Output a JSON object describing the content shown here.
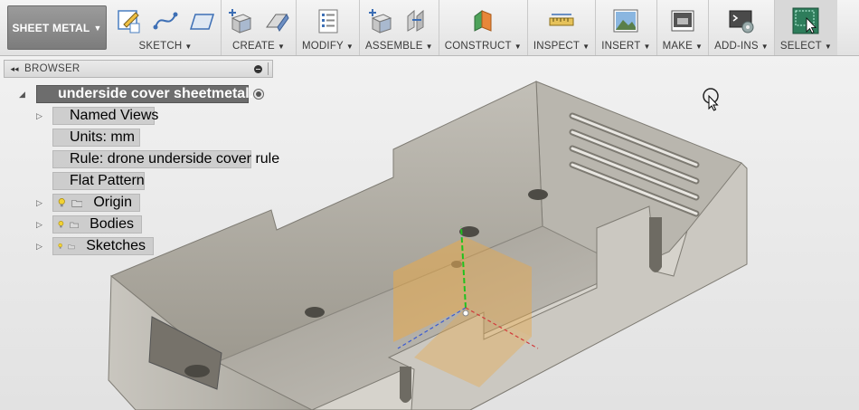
{
  "toolbar": {
    "workspace": "SHEET METAL",
    "groups": [
      {
        "label": "SKETCH"
      },
      {
        "label": "CREATE"
      },
      {
        "label": "MODIFY"
      },
      {
        "label": "ASSEMBLE"
      },
      {
        "label": "CONSTRUCT"
      },
      {
        "label": "INSPECT"
      },
      {
        "label": "INSERT"
      },
      {
        "label": "MAKE"
      },
      {
        "label": "ADD-INS"
      },
      {
        "label": "SELECT"
      }
    ]
  },
  "browser": {
    "title": "BROWSER",
    "root": "underside cover sheetmetal...",
    "items": [
      {
        "label": "Named Views"
      },
      {
        "label": "Units: mm"
      },
      {
        "label": "Rule: drone underside cover rule"
      },
      {
        "label": "Flat Pattern"
      },
      {
        "label": "Origin"
      },
      {
        "label": "Bodies"
      },
      {
        "label": "Sketches"
      }
    ]
  },
  "colors": {
    "accent_select": "#2e7d5b",
    "origin_plane": "#e8a94a",
    "axis_y": "#1fc21f",
    "axis_x": "#d23a3a",
    "axis_z": "#3a5ad2"
  }
}
